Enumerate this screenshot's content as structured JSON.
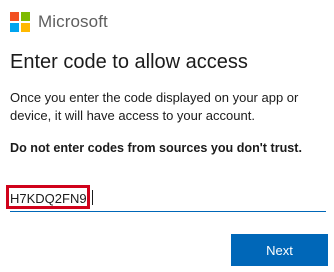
{
  "brand": {
    "name": "Microsoft",
    "logo_colors": [
      "#f25022",
      "#7fba00",
      "#00a4ef",
      "#ffb900"
    ]
  },
  "page": {
    "title": "Enter code to allow access",
    "description": "Once you enter the code displayed on your app or device, it will have access to your account.",
    "warning": "Do not enter codes from sources you don't trust."
  },
  "code_input": {
    "value": "H7KDQ2FN9",
    "highlight_color": "#d0021b"
  },
  "actions": {
    "next_label": "Next",
    "accent_color": "#0067b8"
  }
}
